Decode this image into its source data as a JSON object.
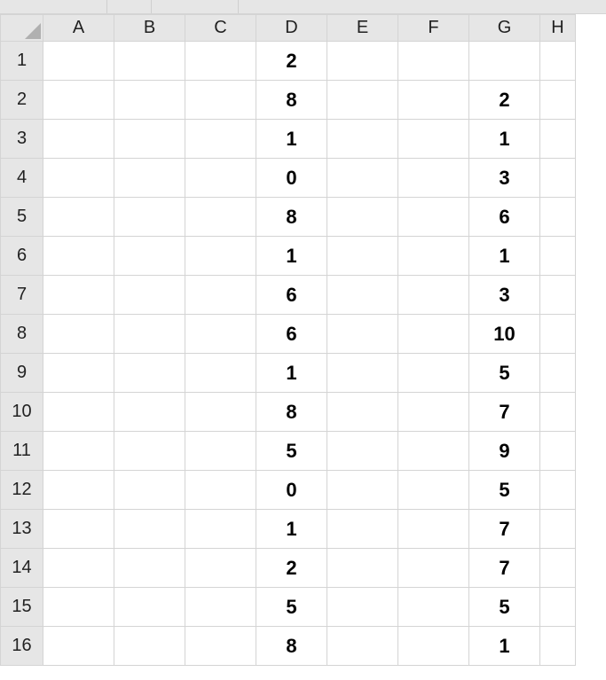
{
  "columns": [
    "A",
    "B",
    "C",
    "D",
    "E",
    "F",
    "G",
    "H"
  ],
  "rows": [
    1,
    2,
    3,
    4,
    5,
    6,
    7,
    8,
    9,
    10,
    11,
    12,
    13,
    14,
    15,
    16
  ],
  "cells": {
    "D1": "2",
    "D2": "8",
    "G2": "2",
    "D3": "1",
    "G3": "1",
    "D4": "0",
    "G4": "3",
    "D5": "8",
    "G5": "6",
    "D6": "1",
    "G6": "1",
    "D7": "6",
    "G7": "3",
    "D8": "6",
    "G8": "10",
    "D9": "1",
    "G9": "5",
    "D10": "8",
    "G10": "7",
    "D11": "5",
    "G11": "9",
    "D12": "0",
    "G12": "5",
    "D13": "1",
    "G13": "7",
    "D14": "2",
    "G14": "7",
    "D15": "5",
    "G15": "5",
    "D16": "8",
    "G16": "1"
  }
}
